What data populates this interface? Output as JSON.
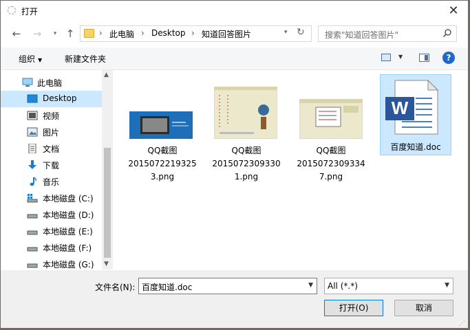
{
  "window": {
    "title": "打开",
    "close_glyph": "✕"
  },
  "nav": {
    "breadcrumb": [
      "此电脑",
      "Desktop",
      "知道回答图片"
    ],
    "separator": "›",
    "search_placeholder": "搜索\"知道回答图片\""
  },
  "toolbar": {
    "organize": "组织",
    "new_folder": "新建文件夹",
    "help": "?"
  },
  "sidebar": {
    "items": [
      {
        "label": "此电脑",
        "icon": "computer-icon"
      },
      {
        "label": "Desktop",
        "icon": "desktop-icon",
        "selected": true
      },
      {
        "label": "视频",
        "icon": "video-icon"
      },
      {
        "label": "图片",
        "icon": "pictures-icon"
      },
      {
        "label": "文档",
        "icon": "documents-icon"
      },
      {
        "label": "下载",
        "icon": "download-icon"
      },
      {
        "label": "音乐",
        "icon": "music-icon"
      },
      {
        "label": "本地磁盘 (C:)",
        "icon": "system-drive-icon"
      },
      {
        "label": "本地磁盘 (D:)",
        "icon": "drive-icon"
      },
      {
        "label": "本地磁盘 (E:)",
        "icon": "drive-icon"
      },
      {
        "label": "本地磁盘 (F:)",
        "icon": "drive-icon"
      },
      {
        "label": "本地磁盘 (G:)",
        "icon": "drive-icon"
      }
    ]
  },
  "files": [
    {
      "line1": "QQ截图",
      "line2": "2015072219325",
      "line3": "3.png",
      "type": "png"
    },
    {
      "line1": "QQ截图",
      "line2": "2015072309330",
      "line3": "1.png",
      "type": "png"
    },
    {
      "line1": "QQ截图",
      "line2": "2015072309334",
      "line3": "7.png",
      "type": "png"
    },
    {
      "line1": "百度知道.doc",
      "type": "doc",
      "selected": true
    }
  ],
  "footer": {
    "filename_label": "文件名(N):",
    "filename_value": "百度知道.doc",
    "filetype_value": "All (*.*)",
    "open_button": "打开(O)",
    "cancel_button": "取消"
  },
  "colors": {
    "selection": "#cce8ff",
    "accent": "#0078d7",
    "help": "#1e68c8"
  }
}
